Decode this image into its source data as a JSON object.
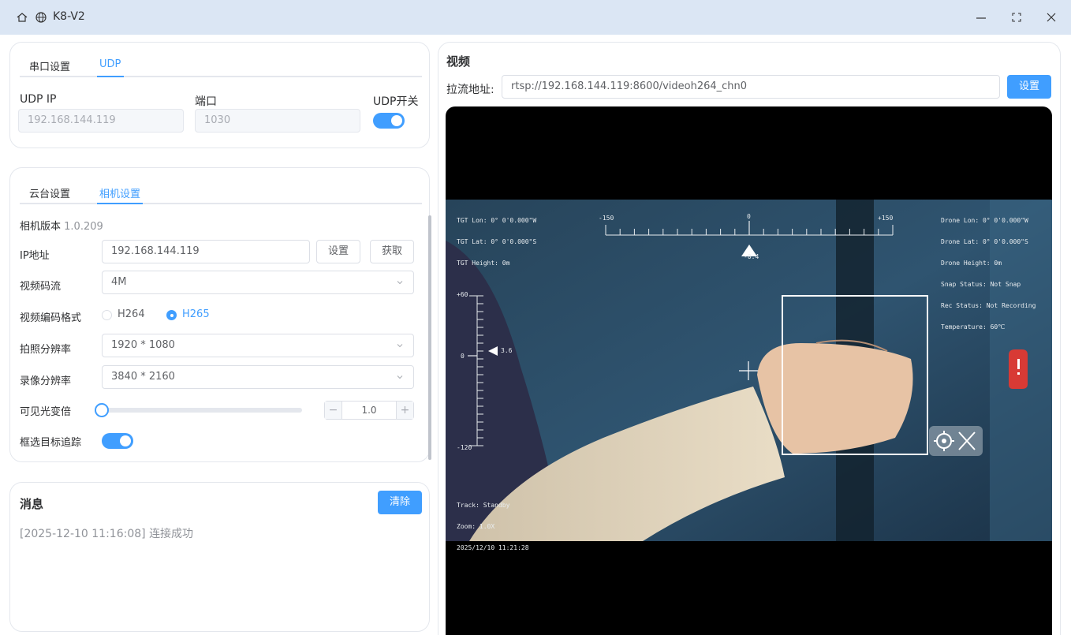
{
  "window": {
    "title": "K8-V2",
    "icons": [
      "home-icon",
      "globe-icon",
      "minimize-icon",
      "maximize-icon",
      "close-icon"
    ]
  },
  "udp_card": {
    "tabs": [
      "串口设置",
      "UDP"
    ],
    "active_tab": "UDP",
    "ip_label": "UDP IP",
    "ip_value": "192.168.144.119",
    "port_label": "端口",
    "port_value": "1030",
    "switch_label": "UDP开关",
    "switch_on": true
  },
  "camera_card": {
    "tabs": [
      "云台设置",
      "相机设置"
    ],
    "active_tab": "相机设置",
    "version_label": "相机版本",
    "version_value": "1.0.209",
    "ip_label": "IP地址",
    "ip_value": "192.168.144.119",
    "set_button": "设置",
    "get_button": "获取",
    "stream_label": "视频码流",
    "stream_value": "4M",
    "codec_label": "视频编码格式",
    "codec_options": [
      "H264",
      "H265"
    ],
    "codec_selected": "H265",
    "photo_res_label": "拍照分辨率",
    "photo_res_value": "1920 * 1080",
    "record_res_label": "录像分辨率",
    "record_res_value": "3840 * 2160",
    "zoom_label": "可见光变倍",
    "zoom_slider_level": 0,
    "zoom_value": "1.0",
    "stepper_minus": "−",
    "stepper_plus": "+",
    "tracking_label": "框选目标追踪",
    "tracking_on": true
  },
  "messages": {
    "title": "消息",
    "clear_button": "清除",
    "items": [
      "[2025-12-10 11:16:08] 连接成功"
    ]
  },
  "video": {
    "title": "视频",
    "url_label": "拉流地址:",
    "url_value": "rtsp://192.168.144.119:8600/videoh264_chn0",
    "set_button": "设置",
    "hud": {
      "tgt_lines": [
        "TGT Lon: 0° 0'0.000\"W",
        "TGT Lat: 0° 0'0.000\"S",
        "TGT Height: 0m"
      ],
      "drone_lines": [
        "Drone Lon: 0° 0'0.000\"W",
        "Drone Lat: 0° 0'0.000\"S",
        "Drone Height: 0m",
        "Snap Status: Not Snap",
        "Rec Status: Not Recording",
        "Temperature: 60℃"
      ],
      "yaw_scale_labels": [
        "-150",
        "0",
        "+150"
      ],
      "yaw_value": "-0.4",
      "pitch_scale_labels": [
        "+60",
        "0",
        "-120"
      ],
      "pitch_value": "3.6",
      "bottom_lines": [
        "Track: Standby",
        "Zoom: 1.0X",
        "2025/12/10 11:21:28"
      ]
    }
  }
}
